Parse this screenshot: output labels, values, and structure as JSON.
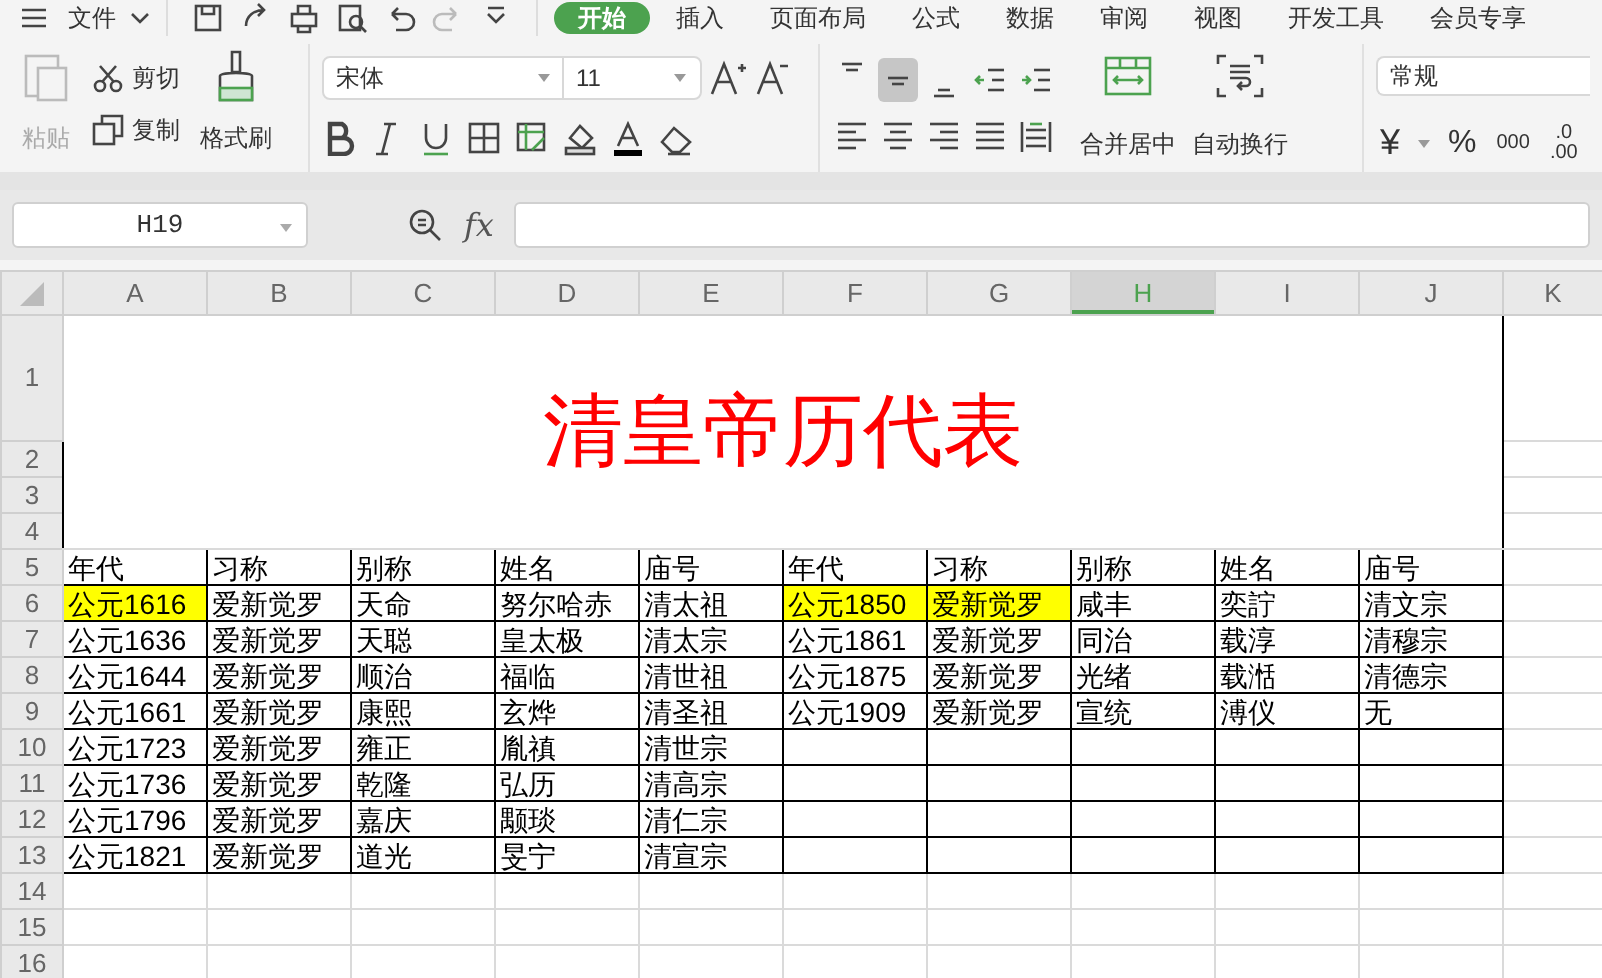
{
  "menu": {
    "file": {
      "label": "文件"
    },
    "tabs": [
      {
        "label": "开始",
        "selected": true
      },
      {
        "label": "插入",
        "selected": false
      },
      {
        "label": "页面布局",
        "selected": false
      },
      {
        "label": "公式",
        "selected": false
      },
      {
        "label": "数据",
        "selected": false
      },
      {
        "label": "审阅",
        "selected": false
      },
      {
        "label": "视图",
        "selected": false
      },
      {
        "label": "开发工具",
        "selected": false
      },
      {
        "label": "会员专享",
        "selected": false
      }
    ]
  },
  "ribbon": {
    "clipboard": {
      "paste": {
        "label": "粘贴",
        "disabled": true
      },
      "cut": "剪切",
      "copy": "复制",
      "format_painter": "格式刷"
    },
    "font": {
      "name": "宋体",
      "size": "11"
    },
    "alignment": {
      "vertical": [
        {
          "kind": "top",
          "selected": false
        },
        {
          "kind": "middle",
          "selected": true
        },
        {
          "kind": "bottom",
          "selected": false
        },
        {
          "kind": "outdent",
          "selected": false
        },
        {
          "kind": "indent",
          "selected": false
        }
      ],
      "horizontal": [
        {
          "kind": "left",
          "selected": false
        },
        {
          "kind": "center",
          "selected": false
        },
        {
          "kind": "right",
          "selected": false
        },
        {
          "kind": "justify",
          "selected": false
        },
        {
          "kind": "distributed",
          "selected": false
        }
      ],
      "merge_center": "合并居中",
      "wrap_text": "自动换行"
    },
    "number": {
      "format": "常规",
      "currency": "¥",
      "percent": "%",
      "thousands": "000",
      "decimal_increase": [
        ".0",
        ".00"
      ]
    }
  },
  "formula_bar": {
    "name_box": "H19",
    "function_label": "fx"
  },
  "sheet": {
    "columns": [
      {
        "label": "A",
        "selected": false
      },
      {
        "label": "B",
        "selected": false
      },
      {
        "label": "C",
        "selected": false
      },
      {
        "label": "D",
        "selected": false
      },
      {
        "label": "E",
        "selected": false
      },
      {
        "label": "F",
        "selected": false
      },
      {
        "label": "G",
        "selected": false
      },
      {
        "label": "H",
        "selected": true
      },
      {
        "label": "I",
        "selected": false
      },
      {
        "label": "J",
        "selected": false
      },
      {
        "label": "K",
        "selected": false
      }
    ],
    "row_headers": [
      "1",
      "2",
      "3",
      "4",
      "5",
      "6",
      "7",
      "8",
      "9",
      "10",
      "11",
      "12",
      "13",
      "14",
      "15",
      "16"
    ],
    "title": "清皇帝历代表",
    "rows": [
      [
        {
          "text": "年代"
        },
        {
          "text": "习称"
        },
        {
          "text": "别称"
        },
        {
          "text": "姓名"
        },
        {
          "text": "庙号"
        },
        {
          "text": "年代"
        },
        {
          "text": "习称"
        },
        {
          "text": "别称"
        },
        {
          "text": "姓名"
        },
        {
          "text": "庙号"
        }
      ],
      [
        {
          "text": "公元1616",
          "color": "#ffff00"
        },
        {
          "text": "爱新觉罗"
        },
        {
          "text": "天命"
        },
        {
          "text": "努尔哈赤"
        },
        {
          "text": "清太祖"
        },
        {
          "text": "公元1850",
          "color": "#ffff00"
        },
        {
          "text": "爱新觉罗",
          "color": "#ffff00"
        },
        {
          "text": "咸丰"
        },
        {
          "text": "奕詝"
        },
        {
          "text": "清文宗"
        }
      ],
      [
        {
          "text": "公元1636"
        },
        {
          "text": "爱新觉罗"
        },
        {
          "text": "天聪"
        },
        {
          "text": "皇太极"
        },
        {
          "text": "清太宗"
        },
        {
          "text": "公元1861"
        },
        {
          "text": "爱新觉罗"
        },
        {
          "text": "同治"
        },
        {
          "text": "载淳"
        },
        {
          "text": "清穆宗"
        }
      ],
      [
        {
          "text": "公元1644"
        },
        {
          "text": "爱新觉罗"
        },
        {
          "text": "顺治"
        },
        {
          "text": "福临"
        },
        {
          "text": "清世祖"
        },
        {
          "text": "公元1875"
        },
        {
          "text": "爱新觉罗"
        },
        {
          "text": "光绪"
        },
        {
          "text": "载湉"
        },
        {
          "text": "清德宗"
        }
      ],
      [
        {
          "text": "公元1661"
        },
        {
          "text": "爱新觉罗"
        },
        {
          "text": "康熙"
        },
        {
          "text": "玄烨"
        },
        {
          "text": "清圣祖"
        },
        {
          "text": "公元1909"
        },
        {
          "text": "爱新觉罗"
        },
        {
          "text": "宣统"
        },
        {
          "text": "溥仪"
        },
        {
          "text": "无"
        }
      ],
      [
        {
          "text": "公元1723"
        },
        {
          "text": "爱新觉罗"
        },
        {
          "text": "雍正"
        },
        {
          "text": "胤禛"
        },
        {
          "text": "清世宗"
        },
        null,
        null,
        null,
        null,
        null
      ],
      [
        {
          "text": "公元1736"
        },
        {
          "text": "爱新觉罗"
        },
        {
          "text": "乾隆"
        },
        {
          "text": "弘历"
        },
        {
          "text": "清高宗"
        },
        null,
        null,
        null,
        null,
        null
      ],
      [
        {
          "text": "公元1796"
        },
        {
          "text": "爱新觉罗"
        },
        {
          "text": "嘉庆"
        },
        {
          "text": "颙琰"
        },
        {
          "text": "清仁宗"
        },
        null,
        null,
        null,
        null,
        null
      ],
      [
        {
          "text": "公元1821"
        },
        {
          "text": "爱新觉罗"
        },
        {
          "text": "道光"
        },
        {
          "text": "旻宁"
        },
        {
          "text": "清宣宗"
        },
        null,
        null,
        null,
        null,
        null
      ]
    ]
  }
}
